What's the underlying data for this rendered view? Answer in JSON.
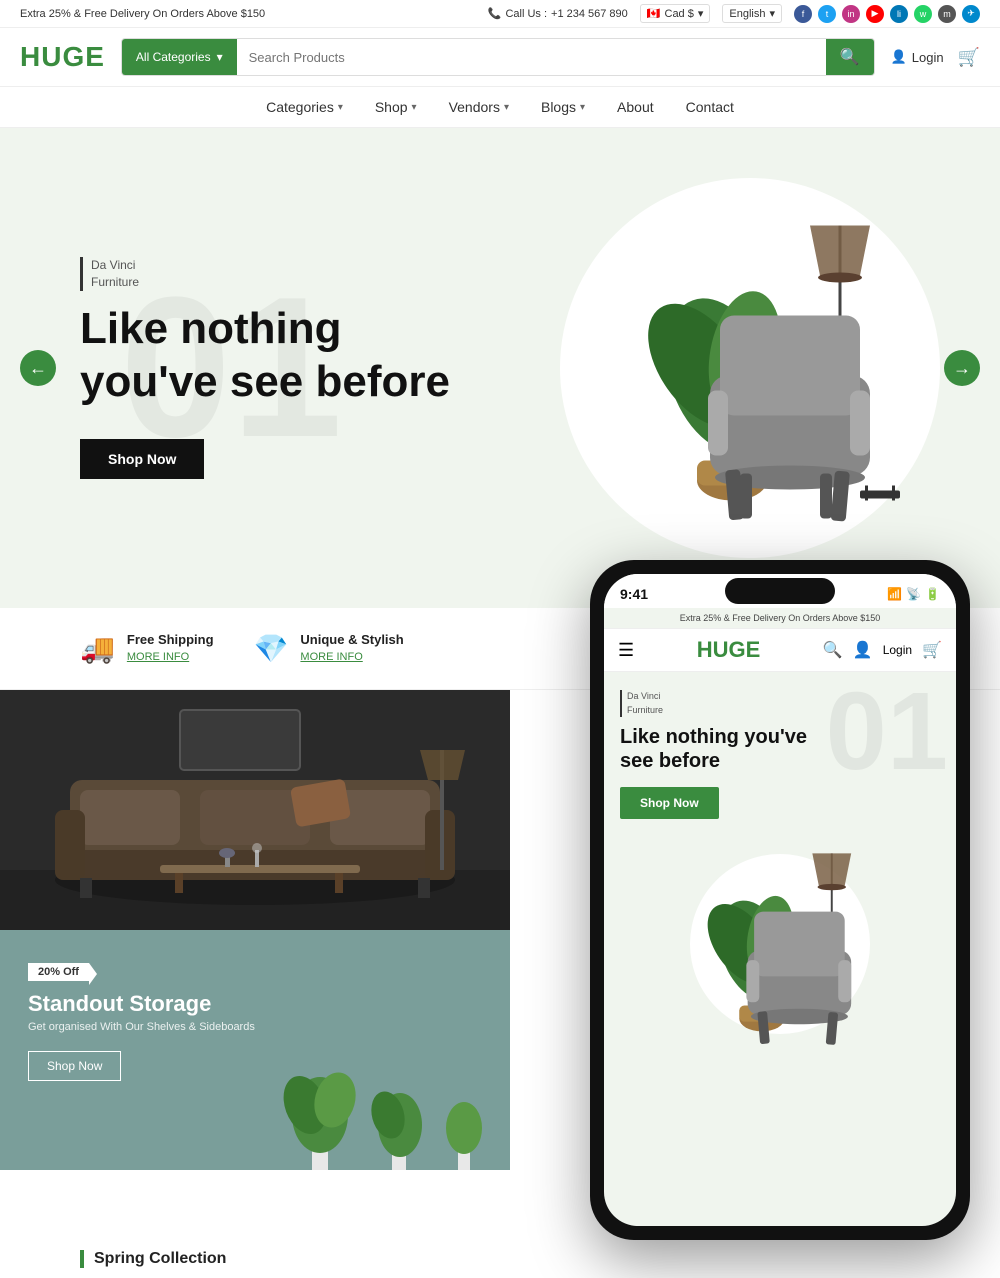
{
  "topbar": {
    "promo": "Extra 25% & Free Delivery On Orders Above $150",
    "phone_label": "Call Us :",
    "phone_number": "+1 234 567 890",
    "currency": "Cad $",
    "language": "English",
    "currency_arrow": "▾",
    "language_arrow": "▾"
  },
  "header": {
    "logo": "HUGE",
    "category_btn": "All Categories",
    "search_placeholder": "Search Products",
    "login_label": "Login"
  },
  "nav": {
    "items": [
      {
        "label": "Categories",
        "has_dropdown": true
      },
      {
        "label": "Shop",
        "has_dropdown": true
      },
      {
        "label": "Vendors",
        "has_dropdown": true
      },
      {
        "label": "Blogs",
        "has_dropdown": true
      },
      {
        "label": "About",
        "has_dropdown": false
      },
      {
        "label": "Contact",
        "has_dropdown": false
      }
    ]
  },
  "hero": {
    "slide_number": "01",
    "brand_line1": "Da Vinci",
    "brand_line2": "Furniture",
    "title": "Like nothing you've see before",
    "shop_btn": "Shop Now"
  },
  "features": [
    {
      "icon": "🚚",
      "title": "Free Shipping",
      "link": "MORE INFO"
    },
    {
      "icon": "💎",
      "title": "Unique & Stylish",
      "link": "MORE INFO"
    }
  ],
  "sofa_card": {
    "alt": "Dark sofa living room"
  },
  "storage_card": {
    "discount": "20% Off",
    "title": "Standout Storage",
    "subtitle": "Get organised With Our Shelves & Sideboards",
    "btn": "Shop Now"
  },
  "spring": {
    "label": "Spring Collection"
  },
  "phone_mockup": {
    "time": "9:41",
    "top_bar": "Extra 25% & Free Delivery On Orders Above $150",
    "logo": "HUGE",
    "login": "Login",
    "slide_label_line1": "Da Vinci",
    "slide_label_line2": "Furniture",
    "hero_title": "Like nothing you've see before",
    "shop_btn": "Shop Now",
    "slide_number": "01"
  },
  "colors": {
    "green": "#3a8c3f",
    "dark": "#111111",
    "teal": "#7a9e9a",
    "hero_bg": "#f0f5ee"
  }
}
